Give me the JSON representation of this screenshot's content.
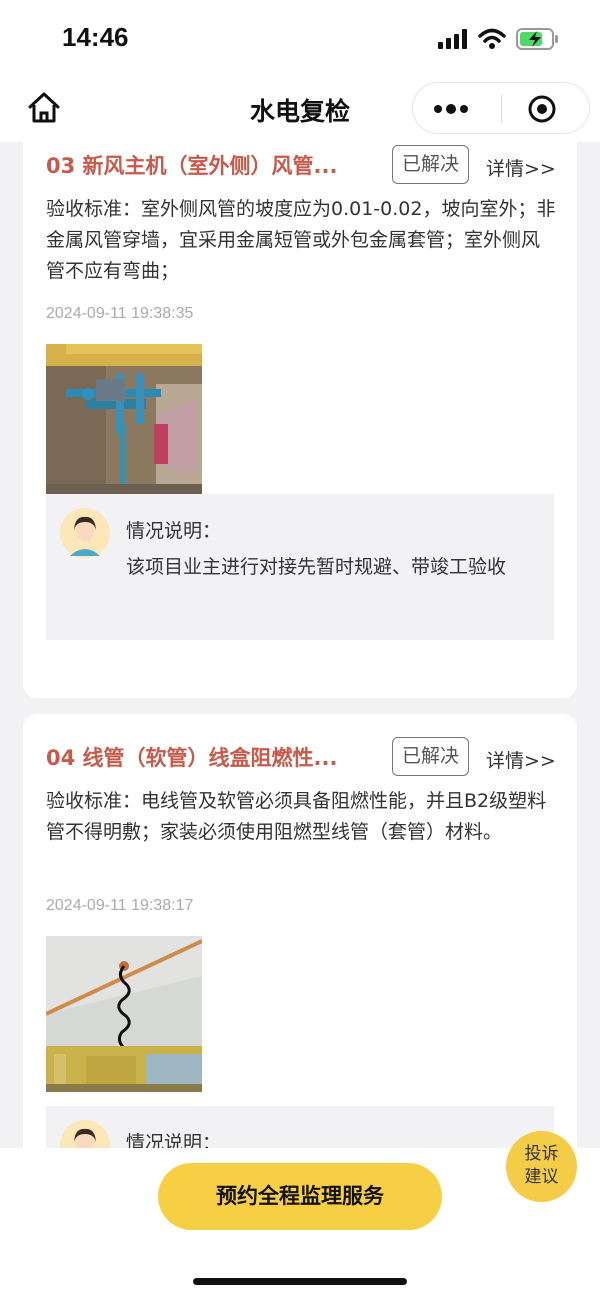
{
  "status_bar": {
    "time": "14:46"
  },
  "nav": {
    "title": "水电复检"
  },
  "items": [
    {
      "title": "03 新风主机（室外侧）风管...",
      "badge": "已解决",
      "details_link": "详情>>",
      "standard": "验收标准：室外侧风管的坡度应为0.01-0.02，坡向室外；非金属风管穿墙，宜采用金属短管或外包金属套管；室外侧风管不应有弯曲；",
      "timestamp": "2024-09-11 19:38:35",
      "note_label": "情况说明：",
      "note_text": "该项目业主进行对接先暂时规避、带竣工验收"
    },
    {
      "title": "04 线管（软管）线盒阻燃性...",
      "badge": "已解决",
      "details_link": "详情>>",
      "standard": "验收标准：电线管及软管必须具备阻燃性能，并且B2级塑料管不得明敷；家装必须使用阻燃型线管（套管）材料。",
      "timestamp": "2024-09-11 19:38:17",
      "note_label": "情况说明："
    }
  ],
  "cta": {
    "label": "预约全程监理服务"
  },
  "fab": {
    "line1": "投诉",
    "line2": "建议"
  },
  "colors": {
    "accent": "#f7cf45",
    "title_red": "#c9594a",
    "note_bg": "#f2f2f5"
  }
}
